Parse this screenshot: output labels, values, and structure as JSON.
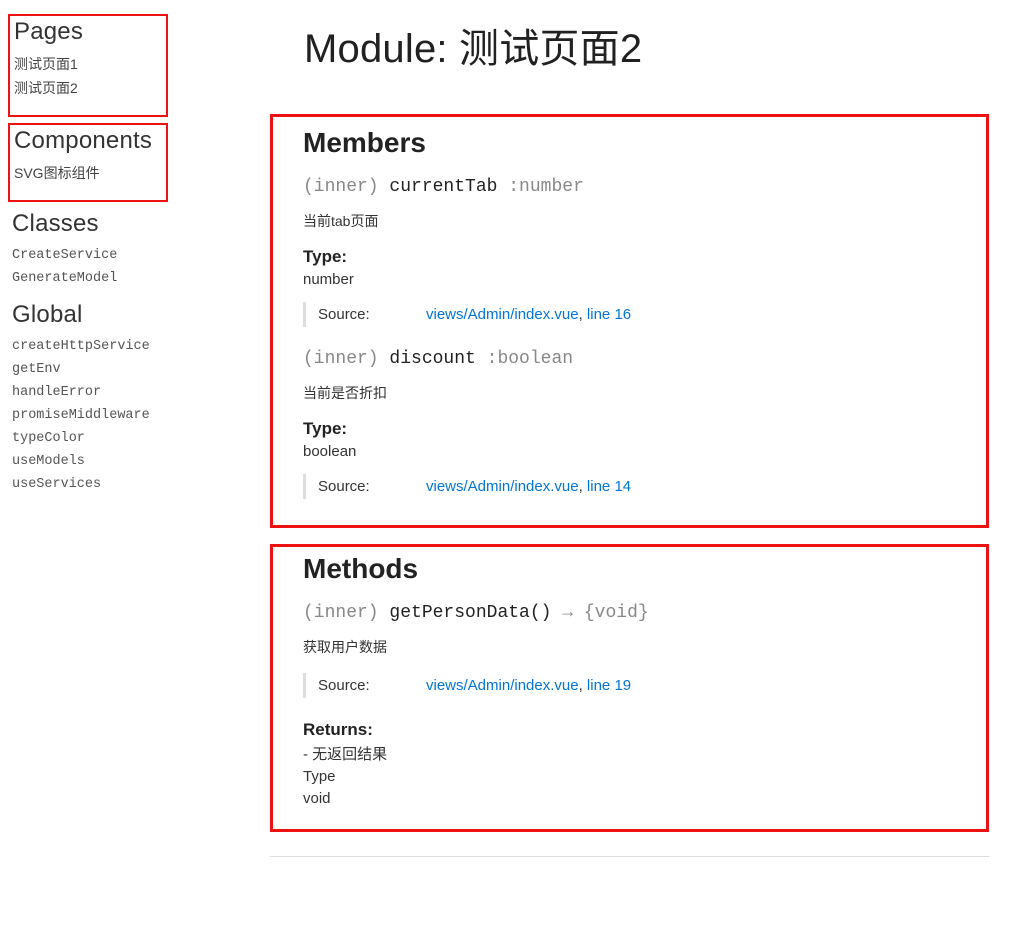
{
  "sidebar": {
    "pages": {
      "heading": "Pages",
      "items": [
        "测试页面1",
        "测试页面2"
      ]
    },
    "components": {
      "heading": "Components",
      "items": [
        "SVG图标组件"
      ]
    },
    "classes": {
      "heading": "Classes",
      "items": [
        "CreateService",
        "GenerateModel"
      ]
    },
    "global": {
      "heading": "Global",
      "items": [
        "createHttpService",
        "getEnv",
        "handleError",
        "promiseMiddleware",
        "typeColor",
        "useModels",
        "useServices"
      ]
    }
  },
  "main": {
    "title": "Module: 测试页面2",
    "members": {
      "heading": "Members",
      "items": [
        {
          "scope": "(inner) ",
          "name": "currentTab",
          "type_annot": " :number",
          "desc": "当前tab页面",
          "type_heading": "Type:",
          "type_value": "number",
          "source_label": "Source:",
          "source_file": "views/Admin/index.vue",
          "sep": ", ",
          "source_line": "line 16"
        },
        {
          "scope": "(inner) ",
          "name": "discount",
          "type_annot": " :boolean",
          "desc": "当前是否折扣",
          "type_heading": "Type:",
          "type_value": "boolean",
          "source_label": "Source:",
          "source_file": "views/Admin/index.vue",
          "sep": ", ",
          "source_line": "line 14"
        }
      ]
    },
    "methods": {
      "heading": "Methods",
      "items": [
        {
          "scope": "(inner) ",
          "name": "getPersonData()",
          "arrow": " → ",
          "ret_annot": "{void}",
          "desc": "获取用户数据",
          "source_label": "Source:",
          "source_file": "views/Admin/index.vue",
          "sep": ", ",
          "source_line": "line 19",
          "returns_heading": "Returns:",
          "returns_text": "- 无返回结果",
          "returns_type_label": "Type",
          "returns_type_value": "void"
        }
      ]
    }
  }
}
